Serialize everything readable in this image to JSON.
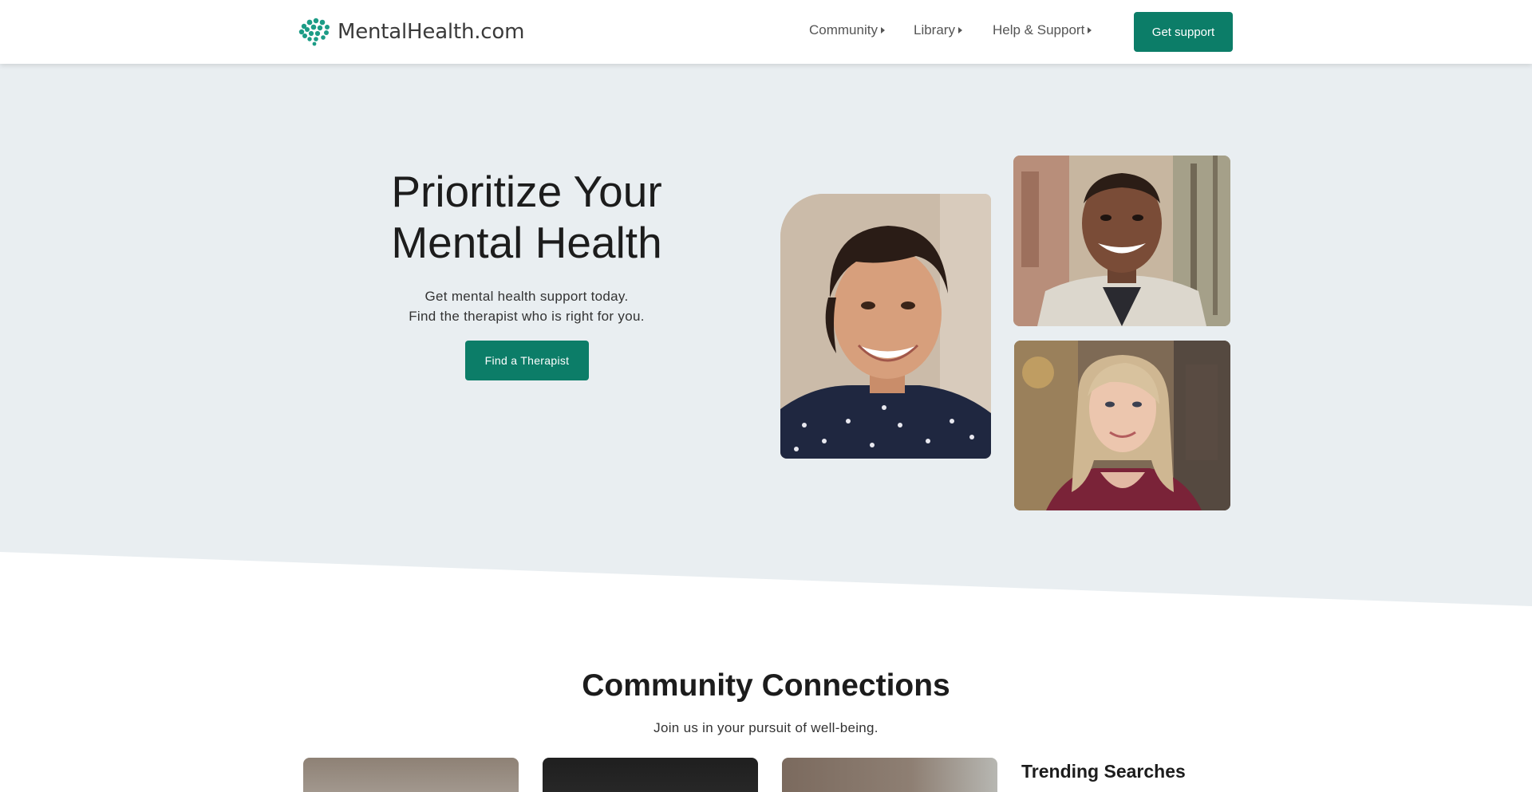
{
  "header": {
    "logo_text": "MentalHealth.com",
    "nav": [
      {
        "label": "Community"
      },
      {
        "label": "Library"
      },
      {
        "label": "Help & Support"
      }
    ],
    "cta_label": "Get support",
    "brand_color": "#0c7d68"
  },
  "hero": {
    "title_line1": "Prioritize Your",
    "title_line2": "Mental Health",
    "subtitle_line1": "Get mental health support today.",
    "subtitle_line2": "Find the therapist who is right for you.",
    "cta_label": "Find a Therapist",
    "photos": [
      "smiling-woman-photo",
      "smiling-man-photo",
      "blonde-woman-photo"
    ]
  },
  "community": {
    "title": "Community Connections",
    "subtitle": "Join us in your pursuit of well-being.",
    "trending_title": "Trending Searches"
  }
}
